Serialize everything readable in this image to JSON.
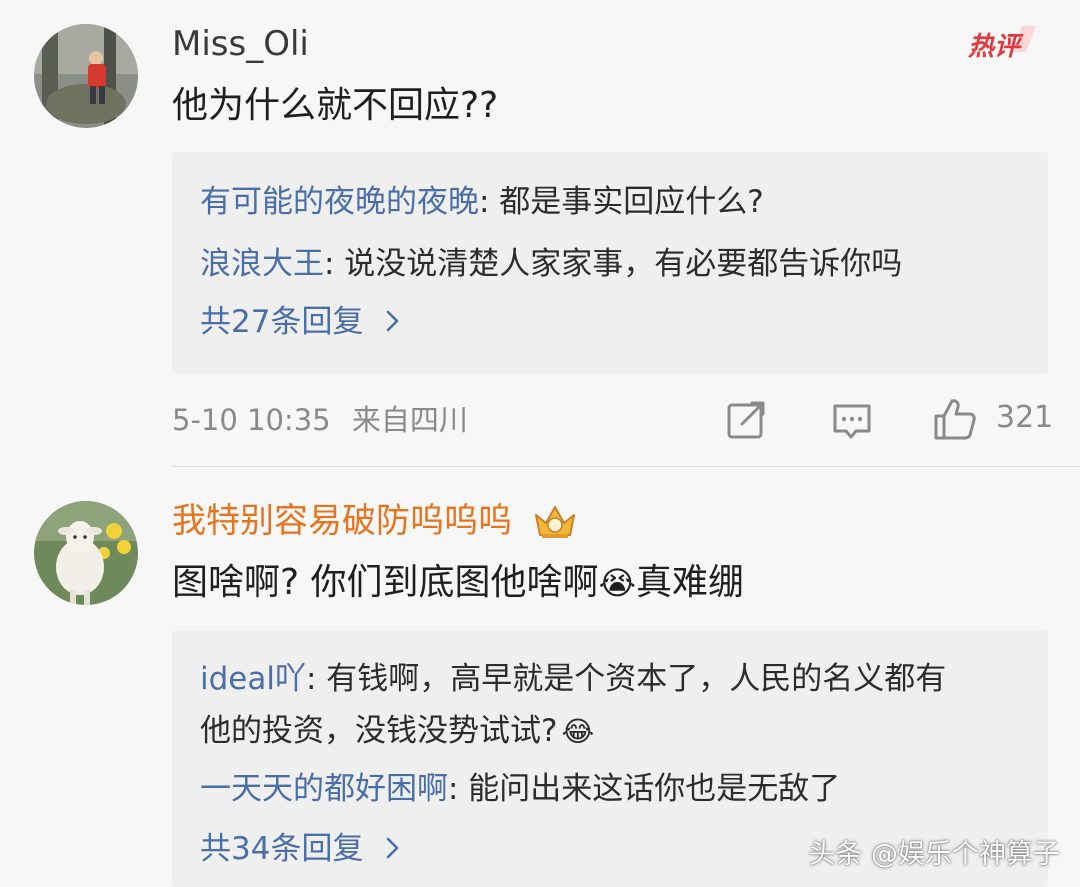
{
  "comments": [
    {
      "username": "Miss_Oli",
      "hot_badge": "热评",
      "text": "他为什么就不回应??",
      "replies": [
        {
          "user": "有可能的夜晚的夜晚",
          "text": ": 都是事实回应什么?"
        },
        {
          "user": "浪浪大王",
          "text": ": 说没说清楚人家家事，有必要都告诉你吗"
        }
      ],
      "more_replies": "共27条回复",
      "more_icon": "chevron-right-icon",
      "timestamp": "5-10 10:35",
      "location": "来自四川",
      "like_count": "321"
    },
    {
      "username": "我特别容易破防呜呜呜",
      "text_part1": "图啥啊? 你们到底图他啥啊",
      "text_emoji": "😭",
      "text_part2": "真难绷",
      "replies": [
        {
          "user": "ideal吖",
          "text": ": 有钱啊，高早就是个资本了，人民的名义都有",
          "text2": "他的投资，没钱没势试试?",
          "emoji": "😂"
        },
        {
          "user": "一天天的都好困啊",
          "text": ": 能问出来这话你也是无敌了"
        }
      ],
      "more_replies": "共34条回复",
      "more_icon": "chevron-right-icon"
    }
  ],
  "watermark": "头条 @娱乐个神算子",
  "colors": {
    "background": "#f7f7f7",
    "reply_box": "#efefef",
    "link_blue": "#4a6ea9",
    "username_orange": "#e8731d",
    "meta_gray": "#8a8a8a",
    "hot_red": "#e4393c"
  }
}
